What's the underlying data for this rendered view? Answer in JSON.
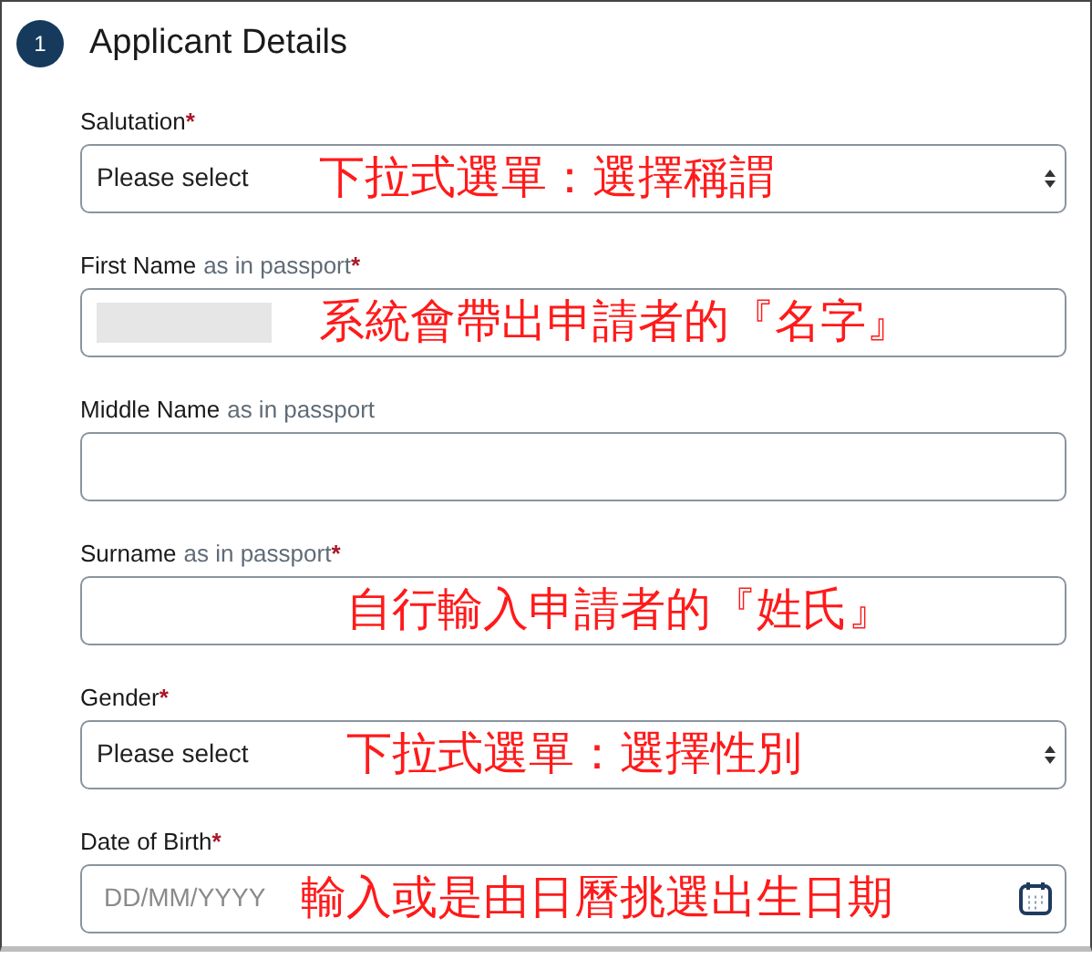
{
  "section": {
    "step": "1",
    "title": "Applicant Details"
  },
  "fields": [
    {
      "kind": "select",
      "label": "Salutation",
      "required_mark": "*",
      "placeholder": "Please select",
      "annotation": "下拉式選單：選擇稱謂"
    },
    {
      "kind": "text",
      "label": "First Name",
      "hint": "as in passport",
      "required_mark": "*",
      "redacted": true,
      "annotation": "系統會帶出申請者的『名字』"
    },
    {
      "kind": "text",
      "label": "Middle Name",
      "hint": "as in passport"
    },
    {
      "kind": "text",
      "label": "Surname",
      "hint": "as in passport",
      "required_mark": "*",
      "annotation": "自行輸入申請者的『姓氏』"
    },
    {
      "kind": "select",
      "label": "Gender",
      "required_mark": "*",
      "placeholder": "Please select",
      "annotation": "下拉式選單：選擇性別"
    },
    {
      "kind": "date",
      "label": "Date of Birth",
      "required_mark": "*",
      "placeholder": "DD/MM/YYYY",
      "annotation": "輸入或是由日曆挑選出生日期"
    }
  ]
}
